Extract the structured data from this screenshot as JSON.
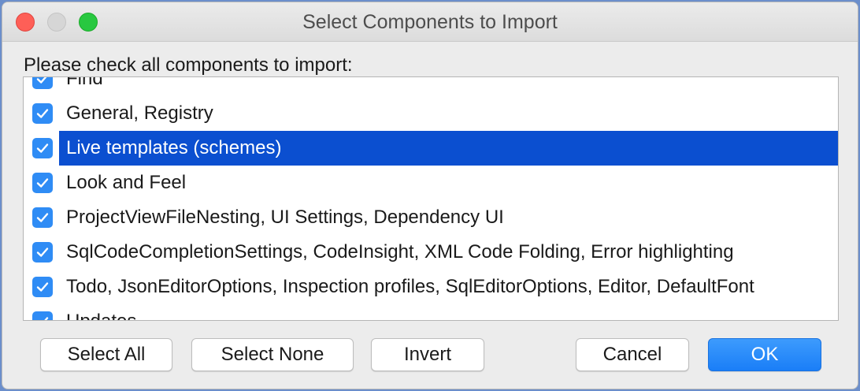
{
  "window": {
    "title": "Select Components to Import"
  },
  "prompt": "Please check all components to import:",
  "list": {
    "items": [
      {
        "label": "Find",
        "checked": true
      },
      {
        "label": "General, Registry",
        "checked": true
      },
      {
        "label": "Live templates (schemes)",
        "checked": true,
        "selected": true
      },
      {
        "label": "Look and Feel",
        "checked": true
      },
      {
        "label": "ProjectViewFileNesting, UI Settings, Dependency UI",
        "checked": true
      },
      {
        "label": "SqlCodeCompletionSettings, CodeInsight, XML Code Folding, Error highlighting",
        "checked": true
      },
      {
        "label": "Todo, JsonEditorOptions, Inspection profiles, SqlEditorOptions, Editor, DefaultFont",
        "checked": true
      },
      {
        "label": "Updates",
        "checked": true
      }
    ]
  },
  "buttons": {
    "select_all": "Select All",
    "select_none": "Select None",
    "invert": "Invert",
    "cancel": "Cancel",
    "ok": "OK"
  },
  "colors": {
    "selection": "#0b4fd0",
    "checkbox": "#2f8cf5",
    "primary_button": "#1a7ef7",
    "close": "#fe5f57",
    "maximize": "#28c840"
  }
}
